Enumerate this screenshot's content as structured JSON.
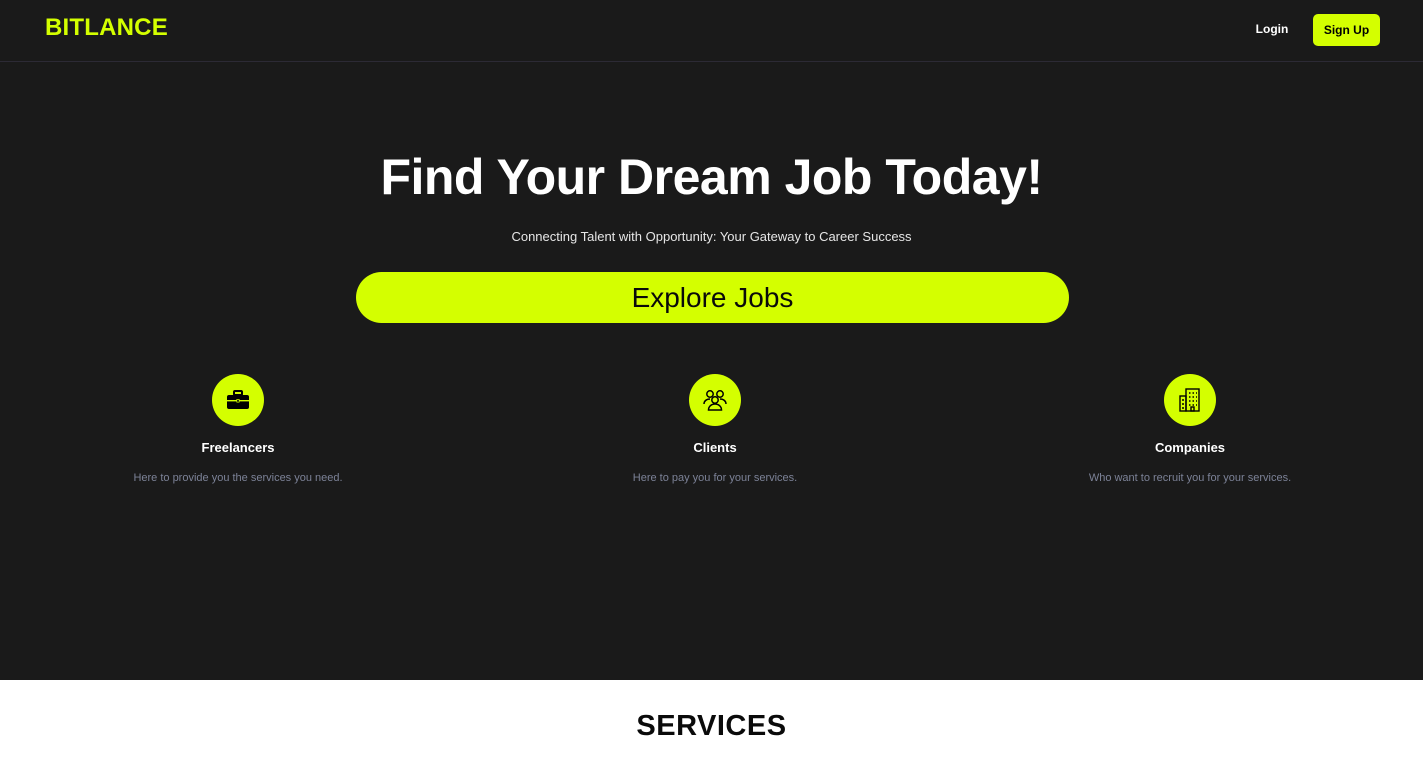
{
  "nav": {
    "logo": "BITLANCE",
    "login_label": "Login",
    "signup_label": "Sign Up"
  },
  "hero": {
    "title": "Find Your Dream Job Today!",
    "subtitle": "Connecting Talent with Opportunity: Your Gateway to Career Success",
    "cta_label": "Explore Jobs"
  },
  "features": [
    {
      "icon": "briefcase-icon",
      "title": "Freelancers",
      "description": "Here to provide you the services you need."
    },
    {
      "icon": "people-icon",
      "title": "Clients",
      "description": "Here to pay you for your services."
    },
    {
      "icon": "building-icon",
      "title": "Companies",
      "description": "Who want to recruit you for your services."
    }
  ],
  "services": {
    "title": "SERVICES"
  },
  "colors": {
    "accent": "#d4ff00",
    "background": "#1a1a1a",
    "muted_text": "#7c8297"
  }
}
